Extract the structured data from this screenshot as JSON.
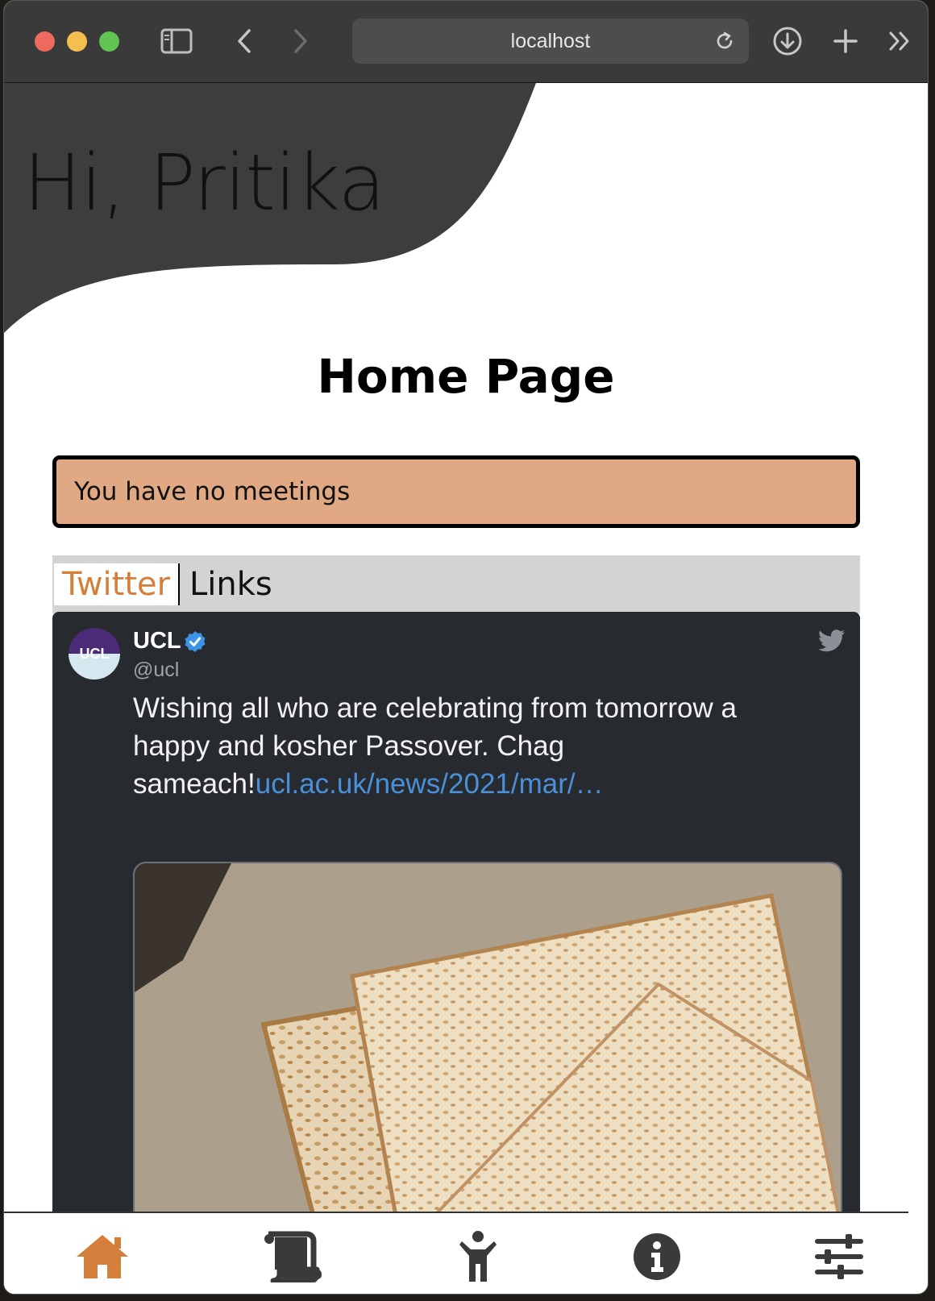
{
  "browser": {
    "url": "localhost"
  },
  "page": {
    "greeting": "Hi, Pritika",
    "title": "Home Page",
    "meetings_message": "You have no meetings"
  },
  "tabs": [
    {
      "label": "Twitter",
      "active": true
    },
    {
      "label": "Links",
      "active": false
    }
  ],
  "tweet": {
    "author": "UCL",
    "handle": "@ucl",
    "avatar_text": "UCL",
    "text": "Wishing all who are celebrating from tomorrow a happy and kosher Passover. Chag sameach!",
    "link": "ucl.ac.uk/news/2021/mar/…"
  },
  "bottom_nav": [
    {
      "icon": "home-icon",
      "active": true
    },
    {
      "icon": "scroll-icon",
      "active": false
    },
    {
      "icon": "person-icon",
      "active": false
    },
    {
      "icon": "info-icon",
      "active": false
    },
    {
      "icon": "sliders-icon",
      "active": false
    }
  ],
  "colors": {
    "accent": "#d47f3c",
    "meeting_bg": "#e0a883",
    "header_dark": "#3d3d3d",
    "tweet_bg": "#272b30",
    "link": "#4a90d9"
  }
}
